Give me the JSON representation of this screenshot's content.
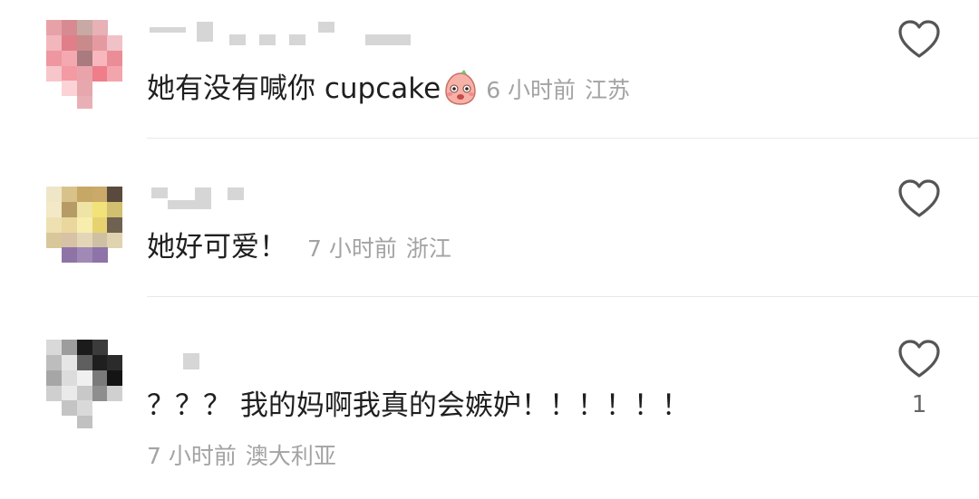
{
  "comments": [
    {
      "text": "她有没有喊你 cupcake",
      "emoji": "blushing-face-emoji",
      "time": "6 小时前",
      "location": "江苏",
      "likes": ""
    },
    {
      "text": "她好可爱！",
      "time": "7 小时前",
      "location": "浙江",
      "likes": ""
    },
    {
      "text": "？？？ 我的妈啊我真的会嫉妒！！！！！！",
      "time": "7 小时前",
      "location": "澳大利亚",
      "likes": "1"
    }
  ],
  "colors": {
    "text": "#1f1f1f",
    "meta": "#a3a3a3",
    "icon": "#555555",
    "divider": "#e9e9e9"
  }
}
